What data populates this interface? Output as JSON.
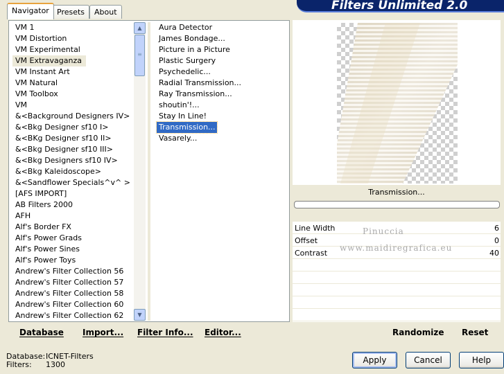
{
  "tabs": [
    {
      "label": "Navigator",
      "active": true
    },
    {
      "label": "Presets",
      "active": false
    },
    {
      "label": "About",
      "active": false
    }
  ],
  "app_title": "Filters Unlimited 2.0",
  "categories": [
    {
      "label": "VM 1",
      "selected": false
    },
    {
      "label": "VM Distortion",
      "selected": false
    },
    {
      "label": "VM Experimental",
      "selected": false
    },
    {
      "label": "VM Extravaganza",
      "selected": true
    },
    {
      "label": "VM Instant Art",
      "selected": false
    },
    {
      "label": "VM Natural",
      "selected": false
    },
    {
      "label": "VM Toolbox",
      "selected": false
    },
    {
      "label": "VM",
      "selected": false
    },
    {
      "label": "&<Background Designers IV>",
      "selected": false
    },
    {
      "label": "&<Bkg Designer sf10 I>",
      "selected": false
    },
    {
      "label": "&<BKg Designer sf10 II>",
      "selected": false
    },
    {
      "label": "&<Bkg Designer sf10 III>",
      "selected": false
    },
    {
      "label": "&<Bkg Designers sf10 IV>",
      "selected": false
    },
    {
      "label": "&<Bkg Kaleidoscope>",
      "selected": false
    },
    {
      "label": "&<Sandflower Specials^v^ >",
      "selected": false
    },
    {
      "label": "[AFS IMPORT]",
      "selected": false
    },
    {
      "label": "AB Filters 2000",
      "selected": false
    },
    {
      "label": "AFH",
      "selected": false
    },
    {
      "label": "Alf's Border FX",
      "selected": false
    },
    {
      "label": "Alf's Power Grads",
      "selected": false
    },
    {
      "label": "Alf's Power Sines",
      "selected": false
    },
    {
      "label": "Alf's Power Toys",
      "selected": false
    },
    {
      "label": "Andrew's Filter Collection 56",
      "selected": false
    },
    {
      "label": "Andrew's Filter Collection 57",
      "selected": false
    },
    {
      "label": "Andrew's Filter Collection 58",
      "selected": false
    },
    {
      "label": "Andrew's Filter Collection 60",
      "selected": false
    },
    {
      "label": "Andrew's Filter Collection 62",
      "selected": false
    }
  ],
  "filters": [
    {
      "label": "Aura Detector",
      "selected": false
    },
    {
      "label": "James Bondage...",
      "selected": false
    },
    {
      "label": "Picture in a Picture",
      "selected": false
    },
    {
      "label": "Plastic Surgery",
      "selected": false
    },
    {
      "label": "Psychedelic...",
      "selected": false
    },
    {
      "label": "Radial Transmission...",
      "selected": false
    },
    {
      "label": "Ray Transmission...",
      "selected": false
    },
    {
      "label": "shoutin'!...",
      "selected": false
    },
    {
      "label": "Stay In Line!",
      "selected": false
    },
    {
      "label": "Transmission...",
      "selected": true
    },
    {
      "label": "Vasarely...",
      "selected": false
    }
  ],
  "left_buttons": {
    "database": "Database",
    "import": "Import...",
    "filter_info": "Filter Info...",
    "editor": "Editor..."
  },
  "preview_label": "Transmission...",
  "params": [
    {
      "name": "Line Width",
      "value": "6"
    },
    {
      "name": "Offset",
      "value": "0"
    },
    {
      "name": "Contrast",
      "value": "40"
    }
  ],
  "watermark": {
    "line1": "Pinuccia",
    "line2": "www.maidiregrafica.eu"
  },
  "right_buttons": {
    "randomize": "Randomize",
    "reset": "Reset"
  },
  "footer": {
    "database_label": "Database:",
    "database_value": "ICNET-Filters",
    "filters_label": "Filters:",
    "filters_value": "1300"
  },
  "dialog_buttons": {
    "apply": "Apply",
    "cancel": "Cancel",
    "help": "Help"
  }
}
